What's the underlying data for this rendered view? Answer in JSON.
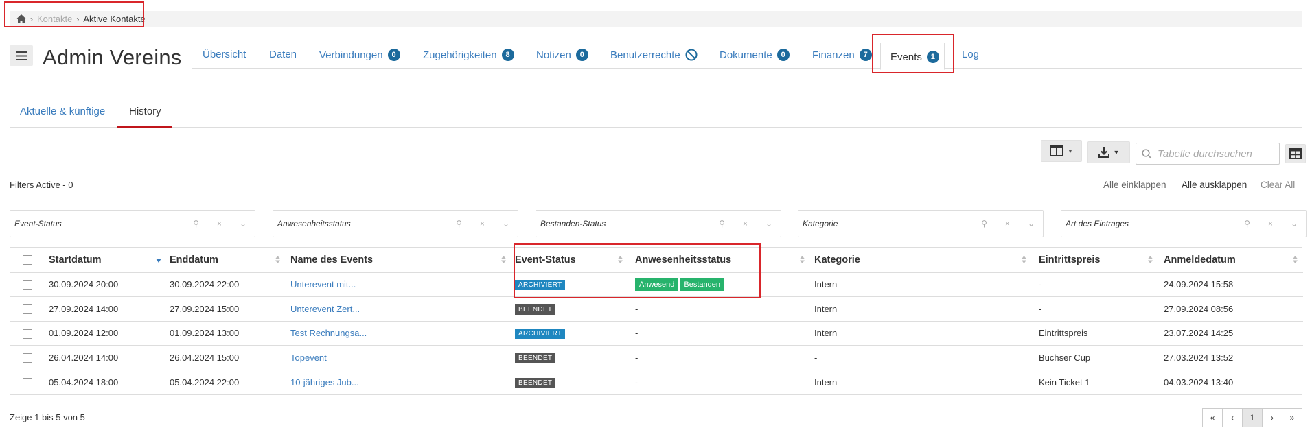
{
  "breadcrumb": {
    "home_icon": "home-icon",
    "items": [
      "Kontakte",
      "Aktive Kontakte"
    ]
  },
  "header": {
    "title": "Admin Vereins",
    "tabs": [
      {
        "label": "Übersicht"
      },
      {
        "label": "Daten"
      },
      {
        "label": "Verbindungen",
        "badge": "0"
      },
      {
        "label": "Zugehörigkeiten",
        "badge": "8"
      },
      {
        "label": "Notizen",
        "badge": "0"
      },
      {
        "label": "Benutzerrechte",
        "icon": "ban-icon"
      },
      {
        "label": "Dokumente",
        "badge": "0"
      },
      {
        "label": "Finanzen",
        "badge": "7"
      },
      {
        "label": "Events",
        "badge": "1",
        "active": true
      },
      {
        "label": "Log"
      }
    ]
  },
  "subtabs": {
    "current": "Aktuelle & künftige",
    "history": "History"
  },
  "toolbar": {
    "search_placeholder": "Tabelle durchsuchen"
  },
  "filters": {
    "active_text": "Filters Active - 0",
    "collapse_all": "Alle einklappen",
    "expand_all": "Alle ausklappen",
    "clear_all": "Clear All",
    "selects": [
      "Event-Status",
      "Anwesenheitsstatus",
      "Bestanden-Status",
      "Kategorie",
      "Art des Eintrages"
    ]
  },
  "table": {
    "columns": [
      "Startdatum",
      "Enddatum",
      "Name des Events",
      "Event-Status",
      "Anwesenheitsstatus",
      "Kategorie",
      "Eintrittspreis",
      "Anmeldedatum"
    ],
    "rows": [
      {
        "start": "30.09.2024 20:00",
        "end": "30.09.2024 22:00",
        "name": "Unterevent mit...",
        "status": "ARCHIVIERT",
        "attendance": [
          "Anwesend",
          "Bestanden"
        ],
        "category": "Intern",
        "price": "-",
        "registered": "24.09.2024 15:58"
      },
      {
        "start": "27.09.2024 14:00",
        "end": "27.09.2024 15:00",
        "name": "Unterevent Zert...",
        "status": "BEENDET",
        "attendance_text": "-",
        "category": "Intern",
        "price": "-",
        "registered": "27.09.2024 08:56"
      },
      {
        "start": "01.09.2024 12:00",
        "end": "01.09.2024 13:00",
        "name": "Test Rechnungsa...",
        "status": "ARCHIVIERT",
        "attendance_text": "-",
        "category": "Intern",
        "price": "Eintrittspreis",
        "registered": "23.07.2024 14:25"
      },
      {
        "start": "26.04.2024 14:00",
        "end": "26.04.2024 15:00",
        "name": "Topevent",
        "status": "BEENDET",
        "attendance_text": "-",
        "category": "-",
        "price": "Buchser Cup",
        "registered": "27.03.2024 13:52"
      },
      {
        "start": "05.04.2024 18:00",
        "end": "05.04.2024 22:00",
        "name": "10-jähriges Jub...",
        "status": "BEENDET",
        "attendance_text": "-",
        "category": "Intern",
        "price": "Kein Ticket 1",
        "registered": "04.03.2024 13:40"
      }
    ]
  },
  "footer": {
    "info_prefix": "Zeige ",
    "info_from": "1",
    "info_mid1": " bis ",
    "info_to": "5",
    "info_mid2": " von ",
    "info_total": "5",
    "current_page": "1"
  },
  "colors": {
    "link": "#3a7cbd",
    "badge": "#1c6a9c",
    "archived": "#1f87c0",
    "done": "#555555",
    "attendance": "#27b36c",
    "annotation": "#d9262b"
  }
}
